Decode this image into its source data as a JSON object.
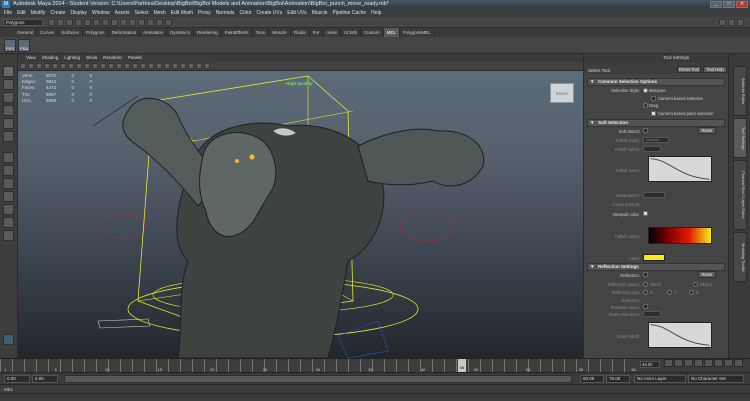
{
  "window": {
    "app_icon": "M",
    "title": "Autodesk Maya 2014 - Student Version: C:\\Users\\Parthea\\Desktop\\BigBoi\\BigBoi Models and Animation\\BigBoi\\Animation\\BigBoi_punch_move_ready.mb*",
    "controls": [
      "_",
      "□",
      "✕"
    ]
  },
  "menu": [
    "File",
    "Edit",
    "Modify",
    "Create",
    "Display",
    "Window",
    "Assets",
    "Select",
    "Mesh",
    "Edit Mesh",
    "Proxy",
    "Normals",
    "Color",
    "Create UVs",
    "Edit UVs",
    "Muscle",
    "Pipeline Cache",
    "Help"
  ],
  "status_line": {
    "mode": "Polygons"
  },
  "shelf_tabs": [
    "General",
    "Curves",
    "Surfaces",
    "Polygons",
    "Deformation",
    "Animation",
    "Dynamics",
    "Rendering",
    "PaintEffects",
    "Toon",
    "Muscle",
    "Fluids",
    "Fur",
    "nHair",
    "nCloth",
    "Custom",
    "MEL",
    "PolygonsMEL"
  ],
  "shelf_active_tab": "MEL",
  "shelf_buttons": [
    "PES",
    "PSA"
  ],
  "panel_menu": [
    "View",
    "Shading",
    "Lighting",
    "Show",
    "Renderer",
    "Panels"
  ],
  "hud": {
    "rows": [
      {
        "label": "Verts:",
        "a": "5570",
        "b": "0",
        "c": "0"
      },
      {
        "label": "Edges:",
        "a": "9843",
        "b": "0",
        "c": "0"
      },
      {
        "label": "Faces:",
        "a": "4473",
        "b": "0",
        "c": "0"
      },
      {
        "label": "Tris:",
        "a": "8807",
        "b": "0",
        "c": "0"
      },
      {
        "label": "UVs:",
        "a": "5998",
        "b": "0",
        "c": "0"
      }
    ],
    "quality": "High Quality"
  },
  "viewcube": "RIGHT",
  "tool_settings": {
    "header": "Tool Settings",
    "title": "Select Tool",
    "reset_label": "Reset Tool",
    "help_label": "Tool Help",
    "common_section": "Common Selection Options",
    "selection_style_label": "Selection Style:",
    "style_marquee": "Marquee",
    "camera_based": "Camera based selection",
    "style_drag": "Drag",
    "camera_paint": "Camera based paint selection",
    "soft_section": "Soft Selection",
    "soft_select_label": "Soft Select:",
    "soft_reset": "Reset",
    "falloff_mode_label": "Falloff mode:",
    "falloff_mode_value": "Volume",
    "falloff_radius_label": "Falloff radius:",
    "falloff_curve_label": "Falloff curve:",
    "interpolation_label": "Interpolation:",
    "curve_presets_label": "Curve presets:",
    "viewport_color_label": "Viewport color:",
    "falloff_colors_label": "Falloff colors:",
    "color_label": "Color:",
    "reflection_section": "Reflection Settings",
    "reflection_label": "Reflection:",
    "reflection_reset": "Reset",
    "reflection_space_label": "Reflection space:",
    "reflection_space_world": "World",
    "reflection_space_object": "Object",
    "reflection_axis_label": "Reflection axis:",
    "reflection_axis_x": "X",
    "reflection_axis_y": "Y",
    "reflection_axis_z": "Z",
    "selection_label": "Selection:",
    "preserve_seam_label": "Preserve seam:",
    "seam_tolerance_label": "Seam Tolerance:",
    "seam_falloff_label": "Seam falloff:"
  },
  "right_tabs": [
    "Attribute Editor",
    "Tool Settings",
    "Channel Box / Layer Editor",
    "Modeling Toolkit"
  ],
  "timeline": {
    "ticks": [
      "1",
      "5",
      "10",
      "15",
      "20",
      "25",
      "30",
      "35",
      "40",
      "45",
      "50",
      "55",
      "60"
    ],
    "current_frame": "46",
    "end_frame": "44.00"
  },
  "range": {
    "start": "0.00",
    "start2": "0.00",
    "end": "60.00",
    "end2": "75.00",
    "anim_layer": "No Anim Layer",
    "char_set": "No Character Set"
  },
  "cmdline_label": "MEL",
  "colors": {
    "ui_bg": "#444444",
    "accent_blue": "#2a7fb8",
    "hq_green": "#7adf6a",
    "wire_yellow": "#e8e830",
    "ramp_yellow": "#f3ee1a"
  }
}
